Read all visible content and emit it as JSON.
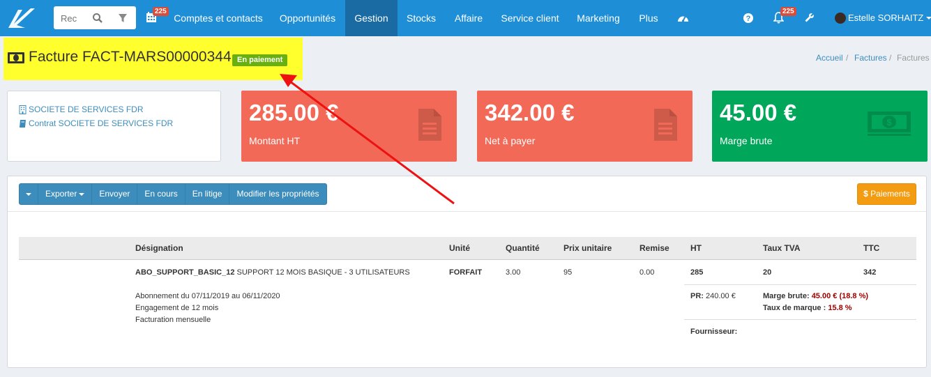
{
  "nav": {
    "search_placeholder": "Rec",
    "calendar_badge": "225",
    "items": [
      {
        "label": "Comptes et contacts"
      },
      {
        "label": "Opportunités"
      },
      {
        "label": "Gestion"
      },
      {
        "label": "Stocks"
      },
      {
        "label": "Affaire"
      },
      {
        "label": "Service client"
      },
      {
        "label": "Marketing"
      },
      {
        "label": "Plus"
      }
    ],
    "notification_badge": "225",
    "user_name": "Estelle SORHAITZ",
    "colors": {
      "bar": "#1e8fd6",
      "active": "#1a6aa3",
      "badge": "#dd4b39"
    }
  },
  "header": {
    "title": "Facture FACT-MARS00000344",
    "status": "En paiement",
    "highlight_color": "#ffff2e",
    "status_color": "#67b010"
  },
  "breadcrumb": {
    "items": [
      "Accueil",
      "Factures",
      "Factures"
    ],
    "separator": "/"
  },
  "info": {
    "company_link": "SOCIETE DE SERVICES FDR",
    "contract_link": "Contrat SOCIETE DE SERVICES FDR"
  },
  "stats": [
    {
      "value": "285.00 €",
      "label": "Montant HT",
      "color": "#f26a57",
      "icon": "document-icon"
    },
    {
      "value": "342.00 €",
      "label": "Net à payer",
      "color": "#f26a57",
      "icon": "document-icon"
    },
    {
      "value": "45.00 €",
      "label": "Marge brute",
      "color": "#00a65a",
      "icon": "money-icon"
    }
  ],
  "toolbar": {
    "buttons": [
      "Exporter",
      "Envoyer",
      "En cours",
      "En litige",
      "Modifier les propriétés"
    ],
    "payments": "Paiements"
  },
  "table": {
    "headers": [
      "Désignation",
      "Unité",
      "Quantité",
      "Prix unitaire",
      "Remise",
      "HT",
      "Taux TVA",
      "TTC"
    ],
    "row": {
      "code": "ABO_SUPPORT_BASIC_12",
      "designation": "SUPPORT 12 MOIS BASIQUE - 3 UTILISATEURS",
      "unit": "FORFAIT",
      "quantity": "3.00",
      "unit_price": "95",
      "discount": "0.00",
      "ht": "285",
      "vat_rate": "20",
      "ttc": "342",
      "description": [
        "Abonnement du 07/11/2019 au 06/11/2020",
        "Engagement de 12 mois",
        "Facturation mensuelle"
      ],
      "pr_label": "PR:",
      "pr_value": "240.00 €",
      "margin_label": "Marge brute:",
      "margin_value": "45.00 € (18.8 %)",
      "markup_label": "Taux de marque :",
      "markup_value": "15.8 %",
      "supplier_label": "Fournisseur:"
    }
  }
}
